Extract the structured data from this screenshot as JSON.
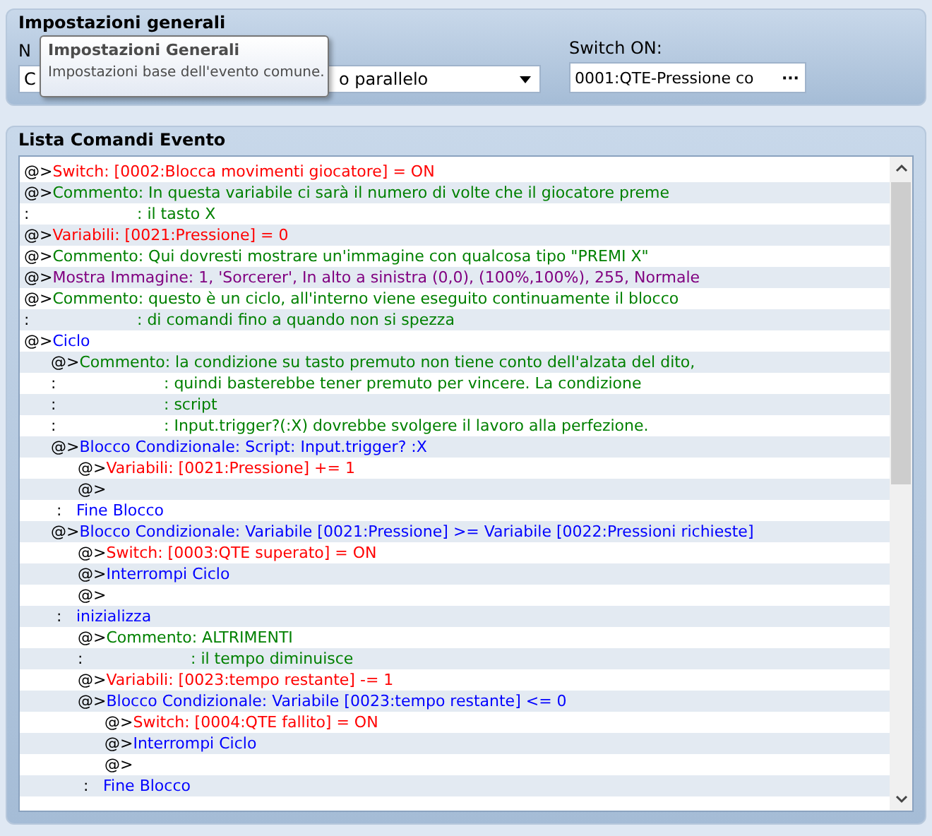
{
  "general": {
    "title": "Impostazioni generali",
    "name_label": "N",
    "name_value": "C",
    "trigger_value": "o parallelo",
    "switch_label": "Switch ON:",
    "switch_value": "0001:QTE-Pressione co",
    "switch_button": "···"
  },
  "tooltip": {
    "title": "Impostazioni Generali",
    "text": "Impostazioni base dell'evento comune."
  },
  "commands": {
    "title": "Lista Comandi Evento",
    "rows": [
      {
        "prefix": "@>",
        "kind": "switch",
        "text": "Switch: [0002:Blocca movimenti giocatore] = ON"
      },
      {
        "prefix": "@>",
        "kind": "comment",
        "text": "Commento: In questa variabile ci sarà il numero di volte che il giocatore preme"
      },
      {
        "prefix": ":",
        "kind": "note",
        "text": ": il tasto X"
      },
      {
        "prefix": "@>",
        "kind": "variable",
        "text": "Variabili: [0021:Pressione] = 0"
      },
      {
        "prefix": "@>",
        "kind": "comment",
        "text": "Commento: Qui dovresti mostrare un'immagine con qualcosa tipo \"PREMI X\""
      },
      {
        "prefix": "@>",
        "kind": "picture",
        "text": "Mostra Immagine: 1, 'Sorcerer', In alto a sinistra (0,0), (100%,100%), 255, Normale"
      },
      {
        "prefix": "@>",
        "kind": "comment",
        "text": "Commento: questo è un ciclo, all'interno viene eseguito continuamente il blocco"
      },
      {
        "prefix": ":",
        "kind": "note",
        "text": ": di comandi fino a quando non si spezza"
      },
      {
        "prefix": "@>",
        "kind": "flow",
        "text": "Ciclo",
        "children": [
          {
            "prefix": "@>",
            "kind": "comment",
            "text": "Commento: la condizione su tasto premuto non tiene conto dell'alzata del dito,"
          },
          {
            "prefix": ":",
            "kind": "note",
            "text": ": quindi basterebbe tener premuto per vincere. La condizione"
          },
          {
            "prefix": ":",
            "kind": "note",
            "text": ": script"
          },
          {
            "prefix": ":",
            "kind": "note",
            "text": ": Input.trigger?(:X) dovrebbe svolgere il lavoro alla perfezione."
          },
          {
            "prefix": "@>",
            "kind": "flow",
            "text": "Blocco Condizionale: Script: Input.trigger? :X",
            "children": [
              {
                "prefix": "@>",
                "kind": "variable",
                "text": "Variabili: [0021:Pressione] += 1"
              },
              {
                "prefix": "@>",
                "kind": "empty"
              }
            ]
          },
          {
            "prefix": ":",
            "kind": "end",
            "text": "Fine Blocco"
          },
          {
            "prefix": "@>",
            "kind": "flow",
            "text": "Blocco Condizionale: Variabile [0021:Pressione] >= Variabile [0022:Pressioni richieste]",
            "children": [
              {
                "prefix": "@>",
                "kind": "switch",
                "text": "Switch: [0003:QTE superato] = ON"
              },
              {
                "prefix": "@>",
                "kind": "flow",
                "text": "Interrompi Ciclo"
              },
              {
                "prefix": "@>",
                "kind": "empty"
              }
            ]
          },
          {
            "prefix": ":",
            "kind": "end",
            "text": "inizializza",
            "children": [
              {
                "prefix": "@>",
                "kind": "comment",
                "text": "Commento: ALTRIMENTI"
              },
              {
                "prefix": ":",
                "kind": "note",
                "text": ": il tempo diminuisce"
              },
              {
                "prefix": "@>",
                "kind": "variable",
                "text": "Variabili: [0023:tempo restante] -= 1"
              },
              {
                "prefix": "@>",
                "kind": "flow",
                "text": "Blocco Condizionale: Variabile [0023:tempo restante] <= 0",
                "children": [
                  {
                    "prefix": "@>",
                    "kind": "switch",
                    "text": "Switch: [0004:QTE fallito] = ON"
                  },
                  {
                    "prefix": "@>",
                    "kind": "flow",
                    "text": "Interrompi Ciclo"
                  },
                  {
                    "prefix": "@>",
                    "kind": "empty"
                  }
                ]
              },
              {
                "prefix": ":",
                "kind": "end",
                "text": "Fine Blocco"
              }
            ]
          }
        ]
      }
    ]
  }
}
